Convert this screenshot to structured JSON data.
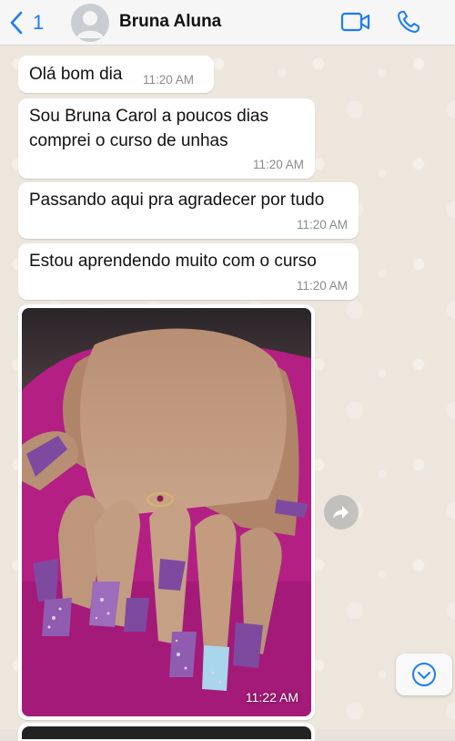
{
  "header": {
    "back_count": "1",
    "contact_name": "Bruna Aluna",
    "accent_color": "#1b7cf5"
  },
  "messages": [
    {
      "text": "Olá bom dia",
      "time": "11:20 AM"
    },
    {
      "text": "Sou Bruna Carol a poucos dias comprei o curso de unhas",
      "time": "11:20 AM"
    },
    {
      "text": "Passando aqui pra agradecer por tudo",
      "time": "11:20 AM"
    },
    {
      "text": "Estou aprendendo muito com o curso",
      "time": "11:20 AM"
    }
  ],
  "image_message": {
    "time": "11:22 AM",
    "icon": "photo-of-hands-with-purple-nails"
  },
  "icons": {
    "back": "chevron-left-icon",
    "video": "video-camera-icon",
    "call": "phone-icon",
    "forward": "forward-arrow-icon",
    "scroll": "chevron-down-circle-icon"
  },
  "colors": {
    "bubble": "#ffffff",
    "chat_bg": "#ece6dd",
    "nail_purple": "#7e4aa0",
    "towel_magenta": "#b41f83"
  }
}
